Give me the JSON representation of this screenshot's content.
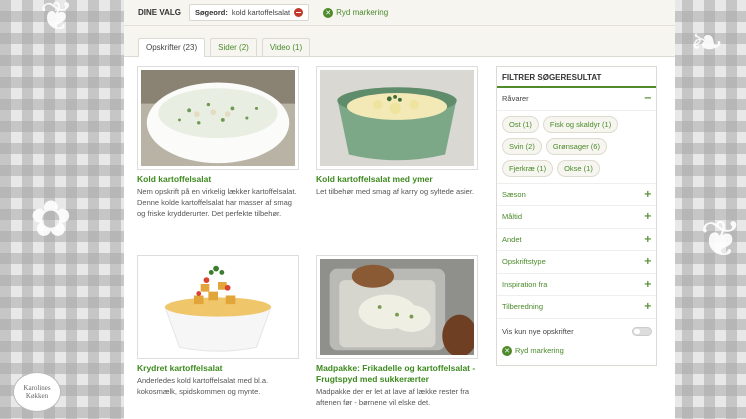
{
  "topbar": {
    "dine_valg": "DINE VALG",
    "search_label": "Søgeord:",
    "search_value": "kold kartoffelsalat",
    "clear_label": "Ryd markering"
  },
  "tabs": [
    {
      "label": "Opskrifter (23)"
    },
    {
      "label": "Sider (2)"
    },
    {
      "label": "Video (1)"
    }
  ],
  "recipes": [
    {
      "title": "Kold kartoffelsalat",
      "desc": "Nem opskrift på en virkelig lækker kartoffelsalat. Denne kolde kartoffelsalat har masser af smag og friske krydderurter. Det perfekte tilbehør."
    },
    {
      "title": "Kold kartoffelsalat med ymer",
      "desc": "Let tilbehør med smag af karry og syltede asier."
    },
    {
      "title": "Krydret kartoffelsalat",
      "desc": "Anderledes kold kartoffelsalat med bl.a. kokosmælk, spidskommen og mynte."
    },
    {
      "title": "Madpakke: Frikadelle og kartoffelsalat - Frugtspyd med sukkerærter",
      "desc": "Madpakke der er let at lave af lække rester fra aftenen før - børnene vil elske det."
    }
  ],
  "filter": {
    "title": "FILTRER SØGERESULTAT",
    "raavarer": "Råvarer",
    "pills": [
      "Ost (1)",
      "Fisk og skaldyr (1)",
      "Svin (2)",
      "Grønsager (6)",
      "Fjerkræ (1)",
      "Okse (1)"
    ],
    "sections": [
      "Sæson",
      "Måltid",
      "Andet",
      "Opskriftstype",
      "Inspiration fra",
      "Tilberedning"
    ],
    "toggle_label": "Vis kun nye opskrifter",
    "clear_label": "Ryd markering"
  },
  "logo": {
    "line1": "Karolines",
    "line2": "Køkken"
  },
  "colors": {
    "accent": "#4f8a2b",
    "title_green": "#3d8a1e",
    "remove_red": "#c0392b"
  }
}
